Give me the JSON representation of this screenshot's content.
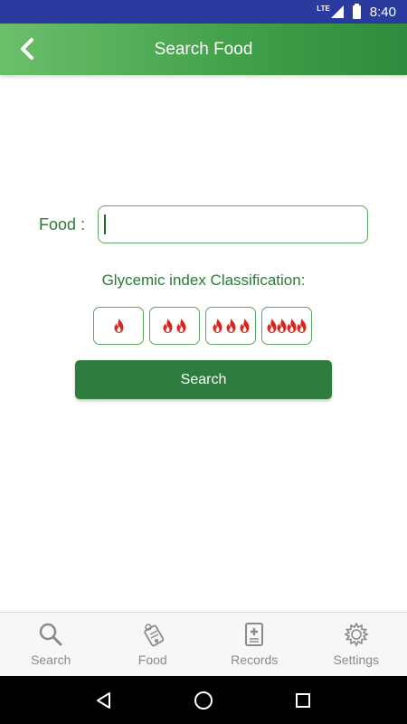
{
  "status_bar": {
    "network": "LTE",
    "time": "8:40"
  },
  "app_bar": {
    "title": "Search Food",
    "back_icon": "chevron-left-icon"
  },
  "form": {
    "food_label": "Food :",
    "food_value": "",
    "food_placeholder": "",
    "gi_heading": "Glycemic index Classification:",
    "gi_options": [
      {
        "flames": 1
      },
      {
        "flames": 2
      },
      {
        "flames": 3
      },
      {
        "flames": 4
      }
    ],
    "search_label": "Search"
  },
  "bottom_nav": {
    "items": [
      {
        "label": "Search",
        "icon": "magnifier-icon"
      },
      {
        "label": "Food",
        "icon": "food-tag-icon"
      },
      {
        "label": "Records",
        "icon": "records-book-icon"
      },
      {
        "label": "Settings",
        "icon": "gear-icon"
      }
    ]
  },
  "colors": {
    "accent_green": "#2e7d3e",
    "label_green": "#2c7a37",
    "flame_red": "#d8261c",
    "status_bar": "#2b3a9e"
  }
}
